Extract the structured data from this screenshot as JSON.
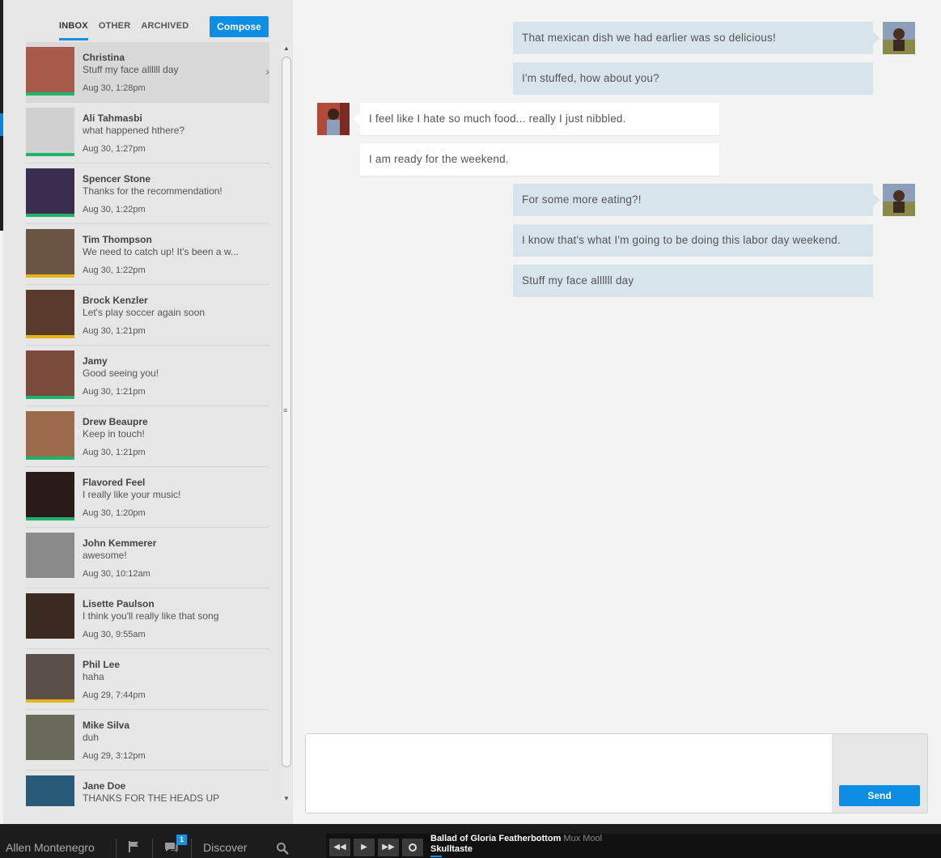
{
  "tabs": [
    {
      "label": "INBOX",
      "active": true
    },
    {
      "label": "OTHER",
      "active": false
    },
    {
      "label": "ARCHIVED",
      "active": false
    }
  ],
  "compose_label": "Compose",
  "conversations": [
    {
      "name": "Christina",
      "preview": "Stuff my face allllll day",
      "time": "Aug 30, 1:28pm",
      "bar": "#1fb36b",
      "pic": "#a85a4a"
    },
    {
      "name": "Ali Tahmasbi",
      "preview": "what happened hthere?",
      "time": "Aug 30, 1:27pm",
      "bar": "#1fb36b",
      "pic": "#d0d0d0"
    },
    {
      "name": "Spencer Stone",
      "preview": "Thanks for the recommendation!",
      "time": "Aug 30, 1:22pm",
      "bar": "#1fb36b",
      "pic": "#3a2d50"
    },
    {
      "name": "Tim Thompson",
      "preview": "We need to catch up! It's been a w...",
      "time": "Aug 30, 1:22pm",
      "bar": "#e6b419",
      "pic": "#6a5545"
    },
    {
      "name": "Brock Kenzler",
      "preview": "Let's play soccer again soon",
      "time": "Aug 30, 1:21pm",
      "bar": "#e6b419",
      "pic": "#5a3a2a"
    },
    {
      "name": "Jamy",
      "preview": "Good seeing you!",
      "time": "Aug 30, 1:21pm",
      "bar": "#1fb36b",
      "pic": "#7a4a3a"
    },
    {
      "name": "Drew Beaupre",
      "preview": "Keep in touch!",
      "time": "Aug 30, 1:21pm",
      "bar": "#1fb36b",
      "pic": "#9a6a4a"
    },
    {
      "name": "Flavored Feel",
      "preview": "I really like your music!",
      "time": "Aug 30, 1:20pm",
      "bar": "#1fb36b",
      "pic": "#2a1a1a"
    },
    {
      "name": "John Kemmerer",
      "preview": "awesome!",
      "time": "Aug 30, 10:12am",
      "bar": "",
      "pic": "#8a8a8a"
    },
    {
      "name": "Lisette Paulson",
      "preview": "I think you'll really like that song",
      "time": "Aug 30, 9:55am",
      "bar": "",
      "pic": "#3a2a22"
    },
    {
      "name": "Phil Lee",
      "preview": "haha",
      "time": "Aug 29, 7:44pm",
      "bar": "#e6b419",
      "pic": "#5a5048"
    },
    {
      "name": "Mike Silva",
      "preview": "duh",
      "time": "Aug 29, 3:12pm",
      "bar": "",
      "pic": "#6a6a5a"
    },
    {
      "name": "Jane Doe",
      "preview": "THANKS FOR THE HEADS UP",
      "time": "",
      "bar": "",
      "pic": "#2a5a7a"
    }
  ],
  "messages": [
    {
      "text": "That mexican dish we had earlier was so delicious!",
      "from": "me"
    },
    {
      "text": "I'm stuffed, how about you?",
      "from": "me"
    },
    {
      "text": "I feel like I hate so much food... really I just nibbled.",
      "from": "them"
    },
    {
      "text": "I am ready for the weekend.",
      "from": "them"
    },
    {
      "text": "For some more eating?!",
      "from": "me"
    },
    {
      "text": "I know that's what I'm going to be doing this labor day weekend.",
      "from": "me"
    },
    {
      "text": "Stuff my face allllll day",
      "from": "me"
    }
  ],
  "composer": {
    "placeholder": "",
    "send_label": "Send"
  },
  "bottom": {
    "user": "Allen Montenegro",
    "notification_count": "1",
    "discover": "Discover",
    "track_title": "Ballad of Gloria Featherbottom",
    "track_artist": "Mux Mool",
    "track_album": "Skulltaste"
  },
  "colors": {
    "accent": "#0d8de3",
    "green": "#1fb36b",
    "yellow": "#e6b419",
    "me_bubble": "#d8e4ec"
  }
}
